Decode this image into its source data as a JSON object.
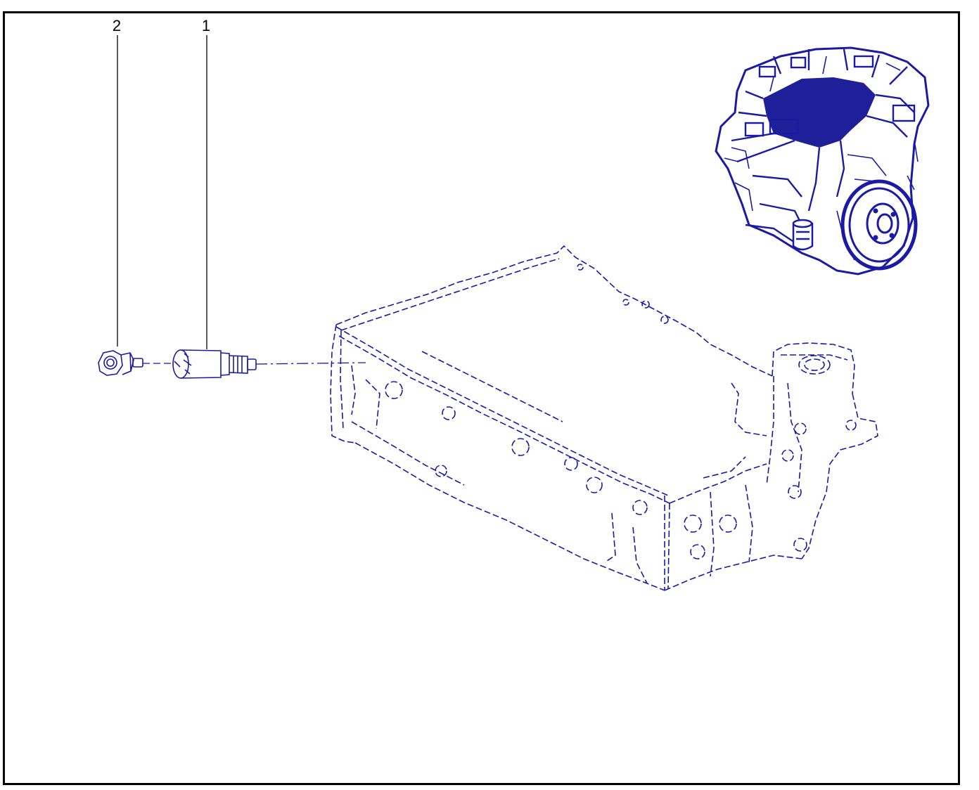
{
  "callouts": [
    {
      "number": "2",
      "part": "bolt"
    },
    {
      "number": "1",
      "part": "sensor"
    }
  ],
  "colors": {
    "line_art": "#1a1aa6",
    "engine_fill": "#1f1f9a",
    "callout_text": "#000000",
    "frame": "#000000",
    "background": "#ffffff"
  }
}
